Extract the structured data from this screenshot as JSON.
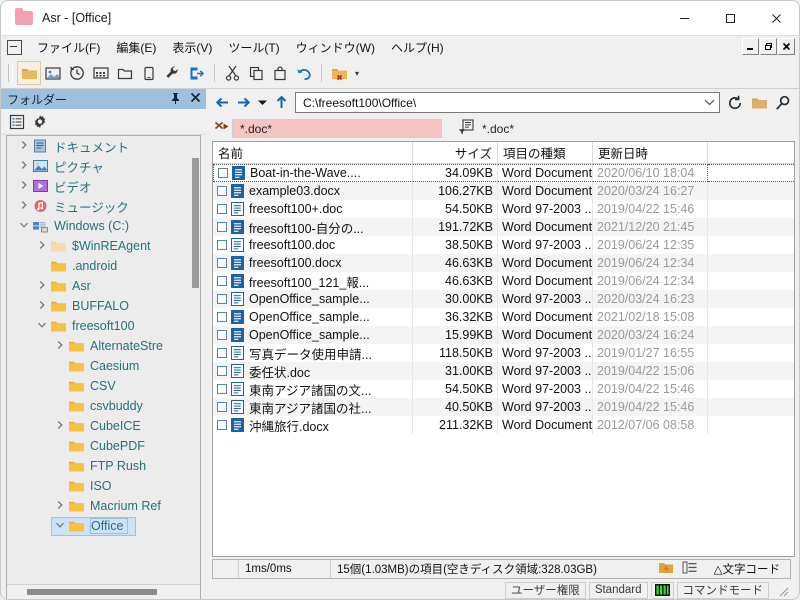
{
  "window": {
    "title": "Asr - [Office]",
    "controls": {
      "minimize": "—",
      "maximize": "□",
      "close": "✕"
    },
    "mdi_controls": {
      "minimize": "_",
      "restore": "❐",
      "close": "✖"
    }
  },
  "menubar": {
    "items": [
      {
        "label": "ファイル(F)",
        "name": "menu-file"
      },
      {
        "label": "編集(E)",
        "name": "menu-edit"
      },
      {
        "label": "表示(V)",
        "name": "menu-view"
      },
      {
        "label": "ツール(T)",
        "name": "menu-tools"
      },
      {
        "label": "ウィンドウ(W)",
        "name": "menu-window"
      },
      {
        "label": "ヘルプ(H)",
        "name": "menu-help"
      }
    ]
  },
  "toolbar": {
    "buttons": [
      {
        "icon": "folder-icon",
        "active": true
      },
      {
        "icon": "image-icon",
        "active": false
      },
      {
        "icon": "history-icon",
        "active": false
      },
      {
        "icon": "grid-icon",
        "active": false
      },
      {
        "icon": "new-folder-icon",
        "active": false
      },
      {
        "icon": "device-icon",
        "active": false
      },
      {
        "icon": "wrench-icon",
        "active": false
      },
      {
        "icon": "exit-icon",
        "active": false
      },
      {
        "icon": "cut-icon",
        "active": false
      },
      {
        "icon": "copy-icon",
        "active": false
      },
      {
        "icon": "paste-icon",
        "active": false
      },
      {
        "icon": "undo-icon",
        "active": false
      },
      {
        "icon": "delete-folder-icon",
        "active": false
      }
    ],
    "dropdown_arrow": "▾"
  },
  "sidebar": {
    "panel_title": "フォルダー",
    "pin_icon": "中",
    "close_icon": "✕",
    "tools": [
      {
        "icon": "list-icon"
      },
      {
        "icon": "gear-icon"
      }
    ],
    "tree": [
      {
        "label": "ドキュメント",
        "indent": 1,
        "chevron": "collapsed",
        "icon": "documents-icon"
      },
      {
        "label": "ピクチャ",
        "indent": 1,
        "chevron": "collapsed",
        "icon": "pictures-icon"
      },
      {
        "label": "ビデオ",
        "indent": 1,
        "chevron": "collapsed",
        "icon": "videos-icon"
      },
      {
        "label": "ミュージック",
        "indent": 1,
        "chevron": "collapsed",
        "icon": "music-icon"
      },
      {
        "label": "Windows (C:)",
        "indent": 1,
        "chevron": "expanded",
        "icon": "drive-icon"
      },
      {
        "label": "$WinREAgent",
        "indent": 2,
        "chevron": "collapsed",
        "icon": "folder-pale-icon"
      },
      {
        "label": ".android",
        "indent": 2,
        "chevron": "none",
        "icon": "folder-icon"
      },
      {
        "label": "Asr",
        "indent": 2,
        "chevron": "collapsed",
        "icon": "folder-icon"
      },
      {
        "label": "BUFFALO",
        "indent": 2,
        "chevron": "collapsed",
        "icon": "folder-icon"
      },
      {
        "label": "freesoft100",
        "indent": 2,
        "chevron": "expanded",
        "icon": "folder-icon"
      },
      {
        "label": "AlternateStre",
        "indent": 3,
        "chevron": "collapsed",
        "icon": "folder-icon"
      },
      {
        "label": "Caesium",
        "indent": 3,
        "chevron": "none",
        "icon": "folder-icon"
      },
      {
        "label": "CSV",
        "indent": 3,
        "chevron": "none",
        "icon": "folder-icon"
      },
      {
        "label": "csvbuddy",
        "indent": 3,
        "chevron": "none",
        "icon": "folder-icon"
      },
      {
        "label": "CubeICE",
        "indent": 3,
        "chevron": "collapsed",
        "icon": "folder-icon"
      },
      {
        "label": "CubePDF",
        "indent": 3,
        "chevron": "none",
        "icon": "folder-icon"
      },
      {
        "label": "FTP Rush",
        "indent": 3,
        "chevron": "none",
        "icon": "folder-icon"
      },
      {
        "label": "ISO",
        "indent": 3,
        "chevron": "none",
        "icon": "folder-icon"
      },
      {
        "label": "Macrium Ref",
        "indent": 3,
        "chevron": "collapsed",
        "icon": "folder-icon"
      },
      {
        "label": "Office",
        "indent": 3,
        "chevron": "expanded",
        "icon": "folder-icon",
        "selected": true
      }
    ]
  },
  "address": {
    "back_icon": "←",
    "forward_icon": "→",
    "history_icon": "▾",
    "up_icon": "↑",
    "path": "C:\\freesoft100\\Office\\",
    "dropdown_icon": "⌄",
    "refresh_icon": "↻",
    "folder_icon": "folder-icon",
    "search_icon": "search-icon"
  },
  "filter": {
    "clear_icon": "clear-filter-icon",
    "value": "*.doc*",
    "placeholder": "*.doc*",
    "secondary_icon": "filter-icon",
    "secondary_label": "*.doc*"
  },
  "filelist": {
    "columns": [
      {
        "key": "name",
        "label": "名前"
      },
      {
        "key": "size",
        "label": "サイズ"
      },
      {
        "key": "type",
        "label": "項目の種類"
      },
      {
        "key": "date",
        "label": "更新日時"
      }
    ],
    "rows": [
      {
        "name": "Boat-in-the-Wave....",
        "size": "34.09KB",
        "type": "Word Document",
        "date": "2020/06/10 18:04",
        "focused": true
      },
      {
        "name": "example03.docx",
        "size": "106.27KB",
        "type": "Word Document",
        "date": "2020/03/24 16:27"
      },
      {
        "name": "freesoft100+.doc",
        "size": "54.50KB",
        "type": "Word 97-2003 ...",
        "date": "2019/04/22 15:46"
      },
      {
        "name": "freesoft100-自分の...",
        "size": "191.72KB",
        "type": "Word Document",
        "date": "2021/12/20 21:45"
      },
      {
        "name": "freesoft100.doc",
        "size": "38.50KB",
        "type": "Word 97-2003 ...",
        "date": "2019/06/24 12:35"
      },
      {
        "name": "freesoft100.docx",
        "size": "46.63KB",
        "type": "Word Document",
        "date": "2019/06/24 12:34"
      },
      {
        "name": "freesoft100_121_報...",
        "size": "46.63KB",
        "type": "Word Document",
        "date": "2019/06/24 12:34"
      },
      {
        "name": "OpenOffice_sample...",
        "size": "30.00KB",
        "type": "Word 97-2003 ...",
        "date": "2020/03/24 16:23"
      },
      {
        "name": "OpenOffice_sample...",
        "size": "36.32KB",
        "type": "Word Document",
        "date": "2021/02/18 15:08"
      },
      {
        "name": "OpenOffice_sample...",
        "size": "15.99KB",
        "type": "Word Document",
        "date": "2020/03/24 16:24"
      },
      {
        "name": "写真データ使用申請...",
        "size": "118.50KB",
        "type": "Word 97-2003 ...",
        "date": "2019/01/27 16:55"
      },
      {
        "name": "委任状.doc",
        "size": "31.00KB",
        "type": "Word 97-2003 ...",
        "date": "2019/04/22 15:06"
      },
      {
        "name": "東南アジア諸国の文...",
        "size": "54.50KB",
        "type": "Word 97-2003 ...",
        "date": "2019/04/22 15:46"
      },
      {
        "name": "東南アジア諸国の社...",
        "size": "40.50KB",
        "type": "Word 97-2003 ...",
        "date": "2019/04/22 15:46"
      },
      {
        "name": "沖縄旅行.docx",
        "size": "211.32KB",
        "type": "Word Document",
        "date": "2012/07/06 08:58"
      }
    ]
  },
  "statusbar": {
    "timing": "1ms/0ms",
    "items": "15個(1.03MB)の項目(空きディスク領域:328.03GB)",
    "icon1": "lightning-folder-icon",
    "icon2": "list-detail-icon",
    "encoding": "△文字コード"
  },
  "bottombar": {
    "permission": "ユーザー権限",
    "standard": "Standard",
    "meter_icon": "meter-icon",
    "command_mode": "コマンドモード"
  },
  "colors": {
    "panel_header": "#9cc0de",
    "filter_bg": "#f7c4c4",
    "selection": "#cde3f5",
    "tree_text": "#26717a",
    "nav_accent": "#1464b4",
    "folder_yellow": "#f7c244",
    "title_icon": "#f3a1ae"
  }
}
